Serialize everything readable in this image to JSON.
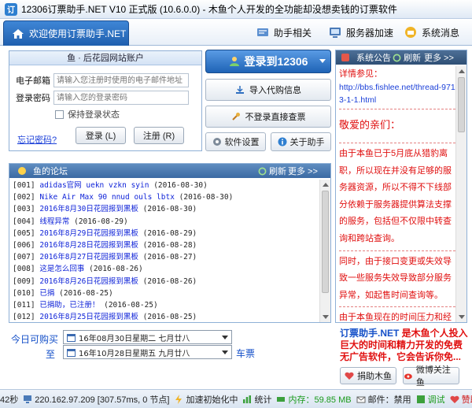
{
  "window": {
    "title": "12306订票助手.NET V10 正式版 (10.6.0.0) - 木鱼个人开发的全功能却没想卖钱的订票软件"
  },
  "topnav": {
    "welcome": "欢迎使用订票助手.NET",
    "help": "助手相关",
    "server": "服务器加速",
    "sysmsg": "系统消息"
  },
  "login": {
    "panel_title": "鱼 · 后花园网站账户",
    "email_label": "电子邮箱",
    "email_placeholder": "请输入您注册时使用的电子邮件地址",
    "password_label": "登录密码",
    "password_placeholder": "请输入您的登录密码",
    "keep_login": "保持登录状态",
    "forgot": "忘记密码?",
    "login_btn": "登录 (L)",
    "register_btn": "注册 (R)"
  },
  "actions": {
    "login12306": "登录到12306",
    "import_passenger": "导入代购信息",
    "query_no_login": "不登录直接查票",
    "settings": "软件设置",
    "about": "关于助手"
  },
  "forum": {
    "title": "鱼的论坛",
    "refresh": "刷新",
    "more": "更多 >>",
    "items": [
      {
        "num": "[001]",
        "title": "adidas官网 uekn vzkn syin",
        "date": "(2016-08-30)"
      },
      {
        "num": "[002]",
        "title": "Nike Air Max 90 nnud ouls lbtx",
        "date": "(2016-08-30)"
      },
      {
        "num": "[003]",
        "title": "2016年8月30日花园报到黑板",
        "date": "(2016-08-30)"
      },
      {
        "num": "[004]",
        "title": "线程异常",
        "date": "(2016-08-29)"
      },
      {
        "num": "[005]",
        "title": "2016年8月29日花园报到黑板",
        "date": "(2016-08-29)"
      },
      {
        "num": "[006]",
        "title": "2016年8月28日花园报到黑板",
        "date": "(2016-08-28)"
      },
      {
        "num": "[007]",
        "title": "2016年8月27日花园报到黑板",
        "date": "(2016-08-27)"
      },
      {
        "num": "[008]",
        "title": "这是怎么回事",
        "date": "(2016-08-26)"
      },
      {
        "num": "[009]",
        "title": "2016年8月26日花园报到黑板",
        "date": "(2016-08-26)"
      },
      {
        "num": "[010]",
        "title": "已捐",
        "date": "(2016-08-25)"
      },
      {
        "num": "[011]",
        "title": "已捐助，已注册！",
        "date": "(2016-08-25)"
      },
      {
        "num": "[012]",
        "title": "2016年8月25日花园报到黑板",
        "date": "(2016-08-25)"
      }
    ]
  },
  "dates": {
    "today_label": "今日可购买",
    "today_value": "16年08月30日星期二  七月廿八",
    "to_label": "至",
    "to_value": "16年10月28日星期五  九月廿八",
    "ticket_label": "车票"
  },
  "notice": {
    "title": "系统公告",
    "refresh": "刷新",
    "more": "更多 >>",
    "see_label": "详情参见：",
    "link": "http://bbs.fishlee.net/thread-9713-1-1.html",
    "greeting": "敬爱的亲们：",
    "para1": "由于本鱼已于5月底从猎豹离职，所以现在并没有足够的服务器资源，所以不得不下线部分依赖于服务器提供算法支撑的服务，包括但不仅限中转查询和跨站查询。",
    "para2": "同时，由于接口变更或失效导致一些服务失效导致部分服务异常，如起售时间查询等。",
    "para3": "由于本鱼现在的时间压力和经"
  },
  "promo": {
    "brand": "订票助手.NET",
    "text": " 是木鱼个人投入巨大的时间和精力开发的免费无广告软件，它会告诉你免..."
  },
  "promo_buttons": {
    "donate": "捐助木鱼",
    "weibo": "微博关注鱼"
  },
  "statusbar": {
    "ms": "42秒",
    "ip": "220.162.97.209 [307.57ms, 0 节点]",
    "accel": "加速初始化中",
    "stats": "统计",
    "memory": "内存：59.85 MB",
    "mail": "邮件：禁用",
    "debug": "调试",
    "donate": "赞助助手"
  },
  "colors": {
    "accent": "#1f5fae",
    "notice_red": "#e01010",
    "link_blue": "#1a3fd8"
  }
}
